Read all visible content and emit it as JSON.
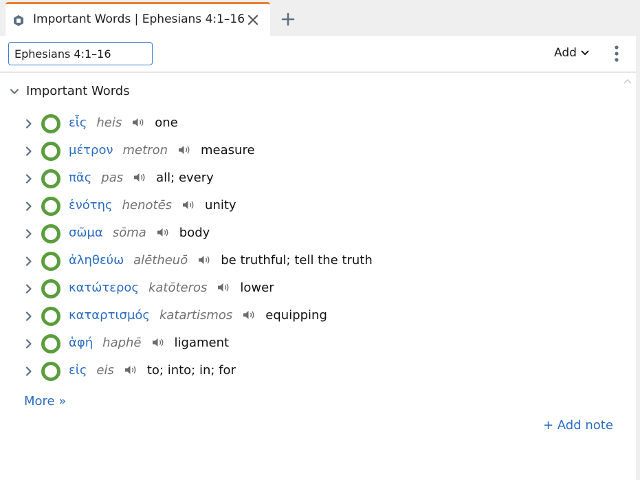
{
  "tab": {
    "title": "Important Words | Ephesians 4:1–16"
  },
  "toolbar": {
    "reference": "Ephesians 4:1–16",
    "add_label": "Add"
  },
  "section": {
    "title": "Important Words"
  },
  "words": [
    {
      "greek": "εἷς",
      "translit": "heis",
      "gloss": "one"
    },
    {
      "greek": "μέτρον",
      "translit": "metron",
      "gloss": "measure"
    },
    {
      "greek": "πᾶς",
      "translit": "pas",
      "gloss": "all; every"
    },
    {
      "greek": "ἑνότης",
      "translit": "henotēs",
      "gloss": "unity"
    },
    {
      "greek": "σῶμα",
      "translit": "sōma",
      "gloss": "body"
    },
    {
      "greek": "ἀληθεύω",
      "translit": "alētheuō",
      "gloss": "be truthful; tell the truth"
    },
    {
      "greek": "κατώτερος",
      "translit": "katōteros",
      "gloss": "lower"
    },
    {
      "greek": "καταρτισμός",
      "translit": "katartismos",
      "gloss": "equipping"
    },
    {
      "greek": "ἁφή",
      "translit": "haphē",
      "gloss": "ligament"
    },
    {
      "greek": "εἰς",
      "translit": "eis",
      "gloss": "to; into; in; for"
    }
  ],
  "more_label": "More »",
  "add_note_label": "+ Add note",
  "colors": {
    "accent": "#2a6cc4",
    "tab_indicator": "#ef7d2d",
    "ring": "#5a9e3c"
  }
}
